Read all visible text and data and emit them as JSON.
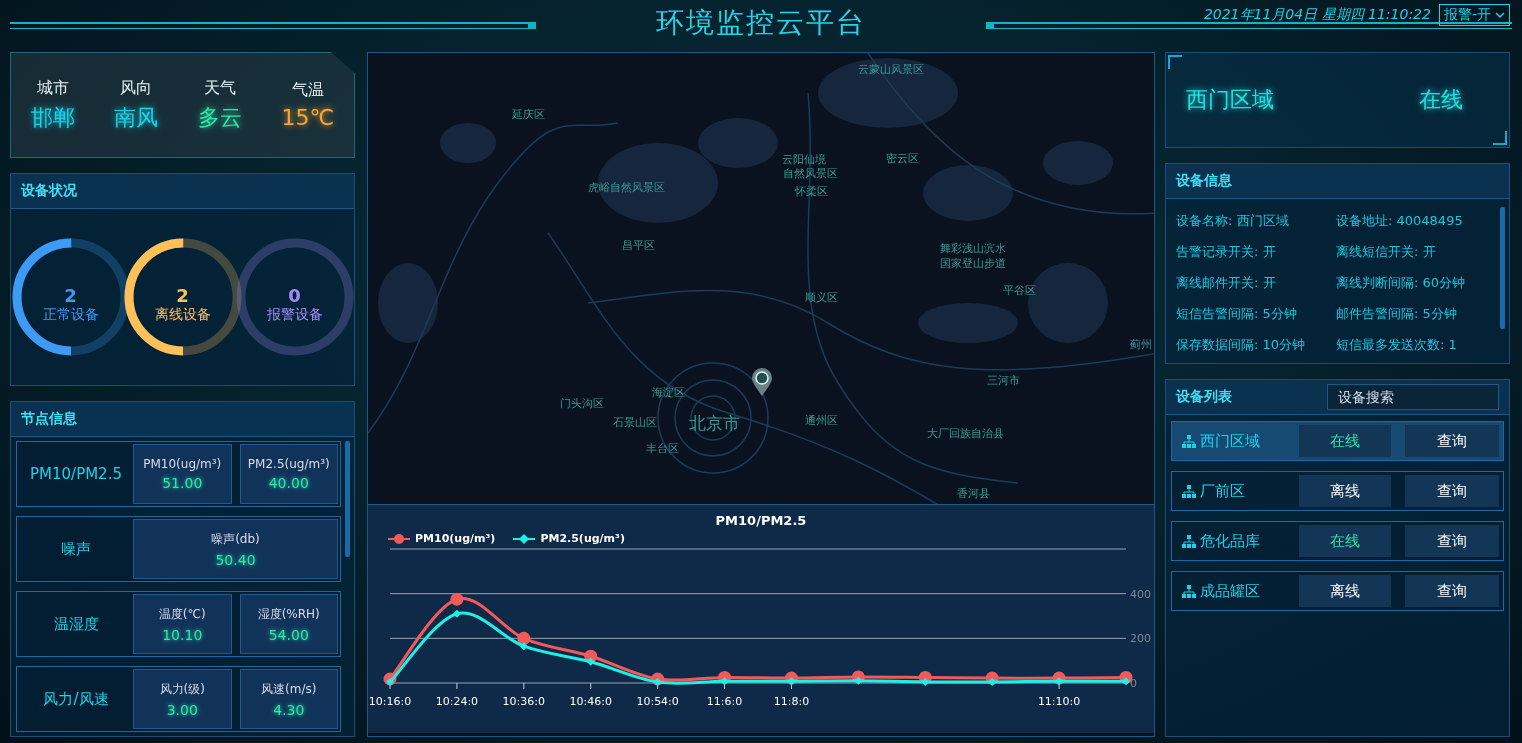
{
  "header": {
    "title": "环境监控云平台",
    "datetime": "2021年11月04日 星期四 11:10:22",
    "alarm_select": {
      "value": "报警-开"
    }
  },
  "weather": [
    {
      "label": "城市",
      "value": "邯郸",
      "color": "#19d3ea"
    },
    {
      "label": "风向",
      "value": "南风",
      "color": "#19d3ea"
    },
    {
      "label": "天气",
      "value": "多云",
      "color": "#2ee6a8"
    },
    {
      "label": "气温",
      "value": "15℃",
      "color": "#f6a531"
    }
  ],
  "device_status": {
    "title": "设备状况",
    "rings": [
      {
        "count": "2",
        "label": "正常设备",
        "level": 0.5,
        "color": "#3d9bf5"
      },
      {
        "count": "2",
        "label": "离线设备",
        "level": 0.5,
        "color": "#ffc05a"
      },
      {
        "count": "0",
        "label": "报警设备",
        "level": 0,
        "color": "#a58cf5"
      }
    ]
  },
  "node_info": {
    "title": "节点信息",
    "groups": [
      {
        "label": "PM10/PM2.5",
        "metrics": [
          {
            "name": "PM10(ug/m³)",
            "value": "51.00"
          },
          {
            "name": "PM2.5(ug/m³)",
            "value": "40.00"
          }
        ]
      },
      {
        "label": "噪声",
        "metrics": [
          {
            "name": "噪声(db)",
            "value": "50.40"
          }
        ]
      },
      {
        "label": "温湿度",
        "metrics": [
          {
            "name": "温度(℃)",
            "value": "10.10"
          },
          {
            "name": "湿度(%RH)",
            "value": "54.00"
          }
        ]
      },
      {
        "label": "风力/风速",
        "metrics": [
          {
            "name": "风力(级)",
            "value": "3.00"
          },
          {
            "name": "风速(m/s)",
            "value": "4.30"
          }
        ]
      }
    ]
  },
  "map": {
    "labels": [
      {
        "text": "云蒙山风景区",
        "kind": "area"
      },
      {
        "text": "延庆区",
        "kind": "area"
      },
      {
        "text": "虎峪自然风景区",
        "kind": "area"
      },
      {
        "text": "云阳仙境",
        "kind": "area"
      },
      {
        "text": "自然风景区",
        "kind": "area"
      },
      {
        "text": "怀柔区",
        "kind": "area"
      },
      {
        "text": "密云区",
        "kind": "area"
      },
      {
        "text": "昌平区",
        "kind": "area"
      },
      {
        "text": "舞彩浅山滨水",
        "kind": "area"
      },
      {
        "text": "国家登山步道",
        "kind": "area"
      },
      {
        "text": "顺义区",
        "kind": "area"
      },
      {
        "text": "平谷区",
        "kind": "area"
      },
      {
        "text": "蓟州",
        "kind": "area"
      },
      {
        "text": "三河市",
        "kind": "area"
      },
      {
        "text": "海淀区",
        "kind": "area"
      },
      {
        "text": "门头沟区",
        "kind": "area"
      },
      {
        "text": "石景山区",
        "kind": "area"
      },
      {
        "text": "北京市",
        "kind": "city"
      },
      {
        "text": "通州区",
        "kind": "area"
      },
      {
        "text": "丰台区",
        "kind": "area"
      },
      {
        "text": "大厂回族自治县",
        "kind": "area"
      },
      {
        "text": "香河县",
        "kind": "area"
      }
    ]
  },
  "chart_data": {
    "type": "line",
    "title": "PM10/PM2.5",
    "categories": [
      "10:16:0",
      "10:24:0",
      "10:36:0",
      "10:46:0",
      "10:54:0",
      "11:6:0",
      "11:8:0",
      null,
      null,
      null,
      "11:10:0",
      null
    ],
    "series": [
      {
        "name": "PM10(ug/m³)",
        "color": "#f25a5a",
        "marker": "circle",
        "values": [
          18,
          375,
          200,
          120,
          18,
          25,
          22,
          27,
          25,
          22,
          22,
          25
        ]
      },
      {
        "name": "PM2.5(ug/m³)",
        "color": "#1ef0e6",
        "marker": "diamond",
        "values": [
          4,
          310,
          165,
          95,
          4,
          8,
          8,
          10,
          5,
          5,
          8,
          8
        ]
      }
    ],
    "ylim": [
      0,
      600
    ],
    "yticks": [
      0,
      200,
      400
    ]
  },
  "current_device": {
    "name": "西门区域",
    "status": "在线"
  },
  "device_info": {
    "title": "设备信息",
    "items": [
      "设备名称: 西门区域",
      "设备地址: 40048495",
      "告警记录开关: 开",
      "离线短信开关: 开",
      "离线邮件开关: 开",
      "离线判断间隔: 60分钟",
      "短信告警间隔: 5分钟",
      "邮件告警间隔: 5分钟",
      "保存数据间隔: 10分钟",
      "短信最多发送次数: 1"
    ]
  },
  "device_list": {
    "title": "设备列表",
    "search": {
      "placeholder": "设备搜索"
    },
    "rows": [
      {
        "name": "西门区域",
        "status": "在线",
        "online": true,
        "selected": true,
        "action": "查询"
      },
      {
        "name": "厂前区",
        "status": "离线",
        "online": false,
        "selected": false,
        "action": "查询"
      },
      {
        "name": "危化品库",
        "status": "在线",
        "online": true,
        "selected": false,
        "action": "查询"
      },
      {
        "name": "成品罐区",
        "status": "离线",
        "online": false,
        "selected": false,
        "action": "查询"
      }
    ]
  }
}
